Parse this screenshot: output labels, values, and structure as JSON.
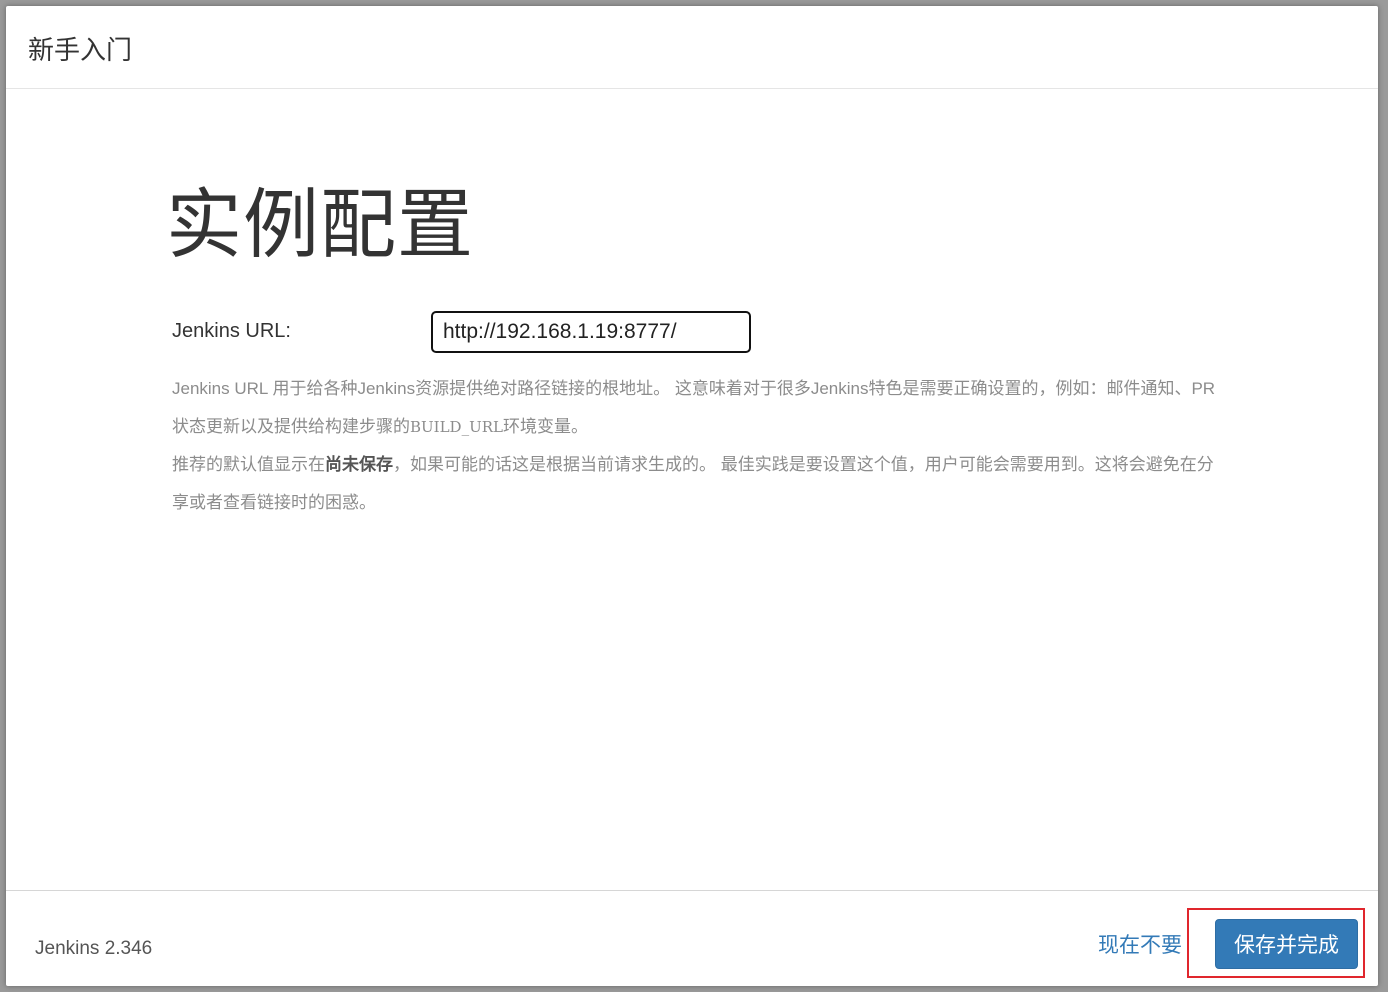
{
  "dialog": {
    "title": "新手入门"
  },
  "main": {
    "heading": "实例配置",
    "url_label": "Jenkins URL:",
    "url_value": "http://192.168.1.19:8777/",
    "help": {
      "p1_a": "Jenkins URL 用于给各种Jenkins资源提供绝对路径链接的根地址。 这意味着对于很多Jenkins特色是需要正确设置的，例如：邮件通知、PR状态更新以及提供给构建步骤的",
      "p1_code": "BUILD_URL",
      "p1_b": "环境变量。",
      "p2_a": "推荐的默认值显示在",
      "p2_strong": "尚未保存",
      "p2_b": "，如果可能的话这是根据当前请求生成的。 最佳实践是要设置这个值，用户可能会需要用到。这将会避免在分享或者查看链接时的困惑。"
    }
  },
  "footer": {
    "version": "Jenkins 2.346",
    "skip_label": "现在不要",
    "save_label": "保存并完成"
  },
  "colors": {
    "primary": "#337ab7",
    "highlight": "#e0262d"
  }
}
